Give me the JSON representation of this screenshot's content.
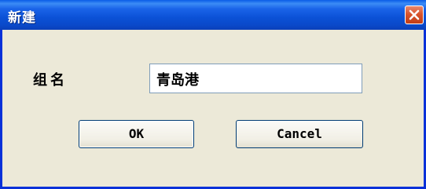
{
  "window": {
    "title": "新建",
    "close_icon": "close-icon"
  },
  "form": {
    "group_name_label": "组名",
    "group_name_value": "青岛港"
  },
  "buttons": {
    "ok_label": "OK",
    "cancel_label": "Cancel"
  },
  "colors": {
    "titlebar": "#0b51d6",
    "dialog_bg": "#ece9d8",
    "close_button": "#d9542c"
  }
}
